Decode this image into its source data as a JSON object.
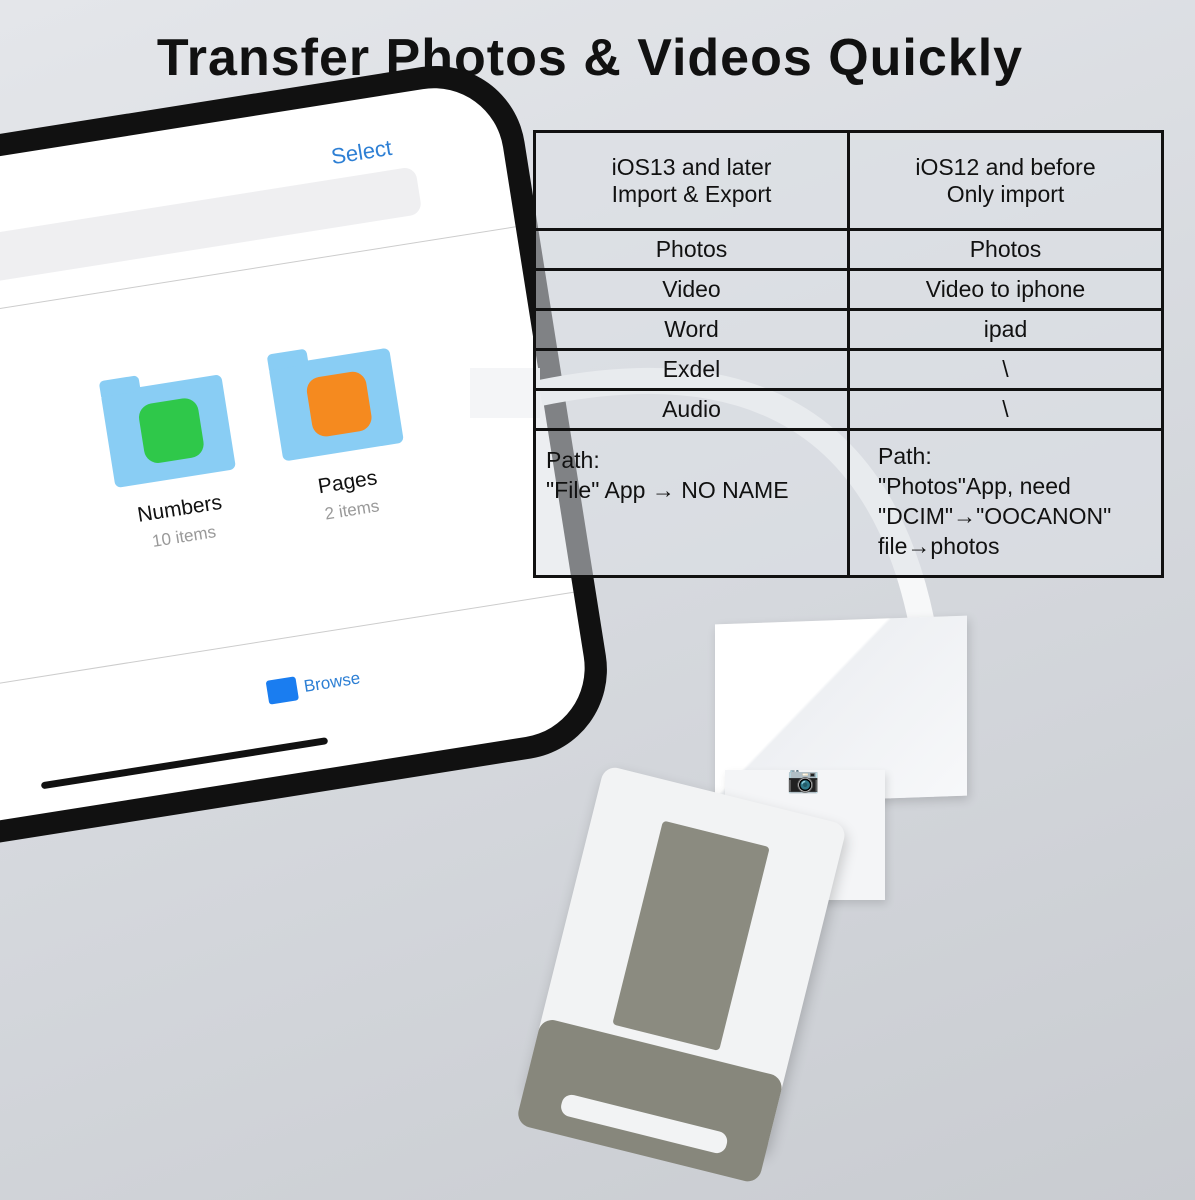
{
  "title": "Transfer Photos & Videos Quickly",
  "phone_screen": {
    "select_label": "Select",
    "folders": [
      {
        "name": "Numbers",
        "count": "10 items",
        "icon": "numbers-app-icon",
        "color": "#2fc84a"
      },
      {
        "name": "Pages",
        "count": "2 items",
        "icon": "pages-app-icon",
        "color": "#f58a1f"
      }
    ],
    "browse_label": "Browse"
  },
  "table": {
    "headers": [
      {
        "line1": "iOS13 and later",
        "line2": "Import & Export"
      },
      {
        "line1": "iOS12 and before",
        "line2": "Only import"
      }
    ],
    "rows": [
      [
        "Photos",
        "Photos"
      ],
      [
        "Video",
        "Video to iphone"
      ],
      [
        "Word",
        "ipad"
      ],
      [
        "Exdel",
        "\\"
      ],
      [
        "Audio",
        "\\"
      ]
    ],
    "path_left": {
      "label": "Path:",
      "text": "\"File\" App → NO NAME"
    },
    "path_right": {
      "label": "Path:",
      "line1": "\"Photos\"App, need",
      "line2": "\"DCIM\"→\"OOCANON\"",
      "line3": "file→photos"
    }
  },
  "adapter": {
    "icon": "camera-icon"
  }
}
